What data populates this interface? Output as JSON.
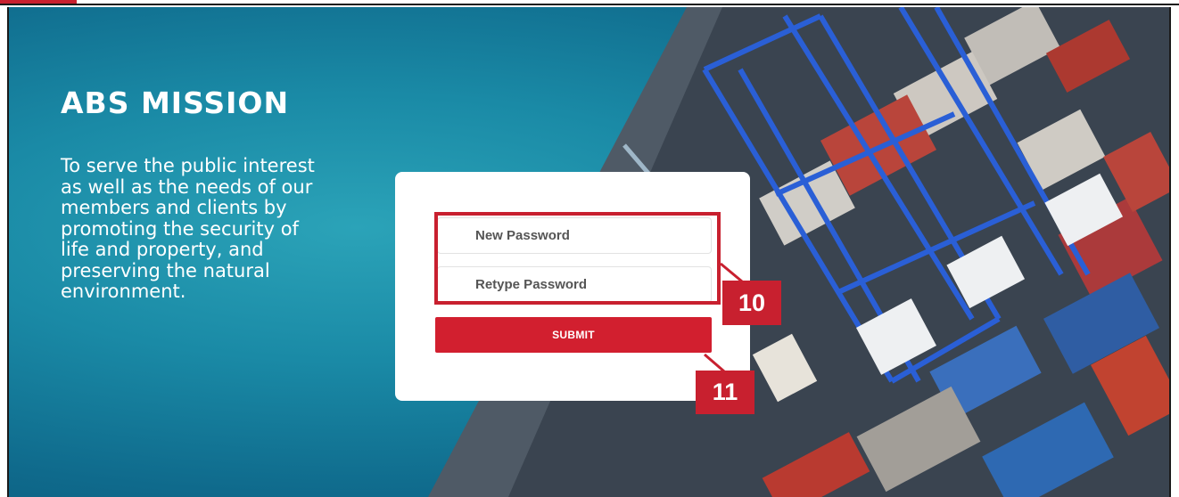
{
  "mission": {
    "title": "ABS MISSION",
    "lines": [
      "To serve the public interest",
      "as well as the needs of our",
      "members and clients by",
      "promoting the security of",
      "life and property, and",
      "preserving the natural",
      "environment."
    ]
  },
  "form": {
    "new_password_placeholder": "New Password",
    "retype_password_placeholder": "Retype Password",
    "submit_label": "SUBMIT"
  },
  "callouts": {
    "password_fields": "10",
    "submit": "11"
  },
  "colors": {
    "accent": "#c8202f",
    "submit_bg": "#d21f2f",
    "sea": "#1a8aa6"
  }
}
